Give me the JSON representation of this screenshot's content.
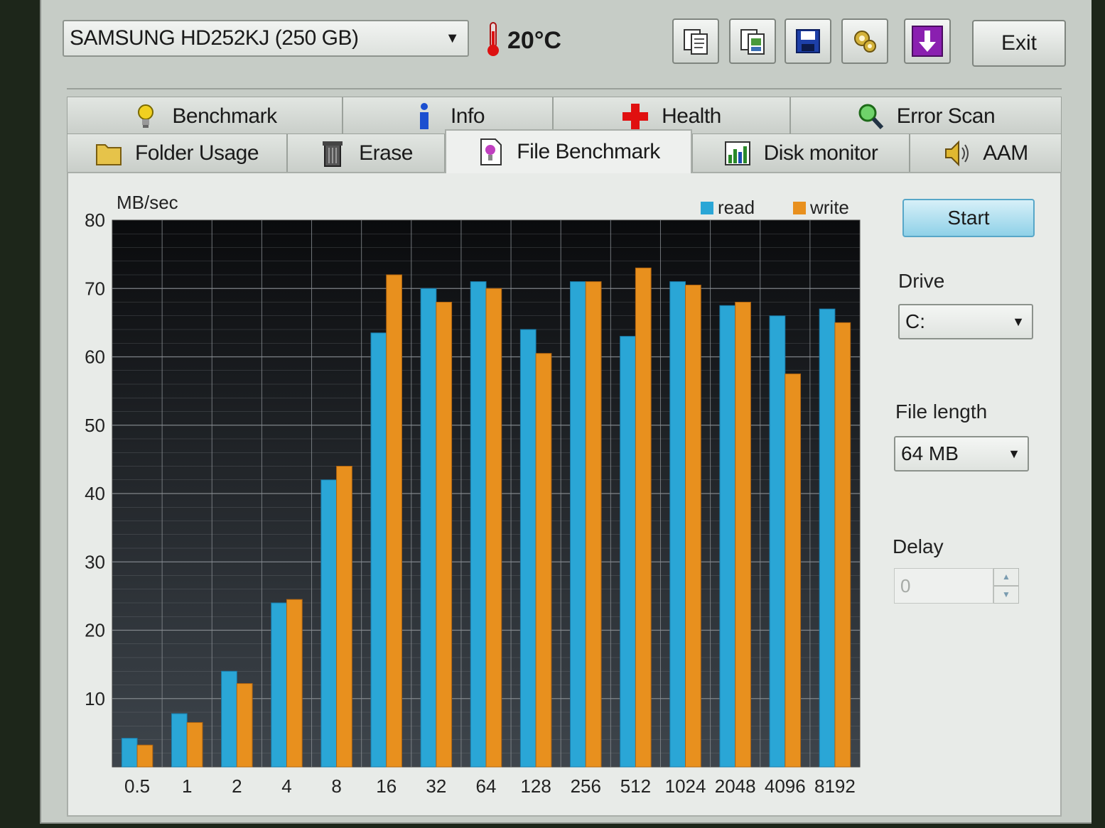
{
  "toolbar": {
    "drive": "SAMSUNG HD252KJ (250 GB)",
    "temperature": "20°C",
    "exit_label": "Exit",
    "buttons": [
      {
        "icon": "copy-text-icon"
      },
      {
        "icon": "copy-screenshot-icon"
      },
      {
        "icon": "save-icon"
      },
      {
        "icon": "options-icon"
      },
      {
        "icon": "download-icon"
      }
    ]
  },
  "tabs": {
    "row1": [
      {
        "label": "Benchmark",
        "icon": "benchmark-icon"
      },
      {
        "label": "Info",
        "icon": "info-icon"
      },
      {
        "label": "Health",
        "icon": "health-icon"
      },
      {
        "label": "Error Scan",
        "icon": "error-scan-icon"
      }
    ],
    "row2": [
      {
        "label": "Folder Usage",
        "icon": "folder-icon"
      },
      {
        "label": "Erase",
        "icon": "erase-icon"
      },
      {
        "label": "File Benchmark",
        "icon": "file-benchmark-icon",
        "active": true
      },
      {
        "label": "Disk monitor",
        "icon": "disk-monitor-icon"
      },
      {
        "label": "AAM",
        "icon": "aam-icon"
      }
    ]
  },
  "side": {
    "start_label": "Start",
    "drive_label": "Drive",
    "drive_value": "C:",
    "file_length_label": "File length",
    "file_length_value": "64 MB",
    "delay_label": "Delay",
    "delay_value": "0"
  },
  "colors": {
    "read": "#2aa6d6",
    "write": "#e8901e",
    "plot_bg_top": "#0a0b0d",
    "plot_bg_bottom": "#3e454c",
    "grid": "#8a8f94"
  },
  "chart_data": {
    "type": "bar",
    "ylabel": "MB/sec",
    "ylim": [
      0,
      80
    ],
    "yticks": [
      10,
      20,
      30,
      40,
      50,
      60,
      70,
      80
    ],
    "categories": [
      "0.5",
      "1",
      "2",
      "4",
      "8",
      "16",
      "32",
      "64",
      "128",
      "256",
      "512",
      "1024",
      "2048",
      "4096",
      "8192"
    ],
    "series": [
      {
        "name": "read",
        "values": [
          4.2,
          7.8,
          14.0,
          24.0,
          42.0,
          63.5,
          70.0,
          71.0,
          64.0,
          71.0,
          63.0,
          71.0,
          67.5,
          66.0,
          67.0
        ]
      },
      {
        "name": "write",
        "values": [
          3.2,
          6.5,
          12.2,
          24.5,
          44.0,
          72.0,
          68.0,
          70.0,
          60.5,
          71.0,
          73.0,
          70.5,
          68.0,
          57.5,
          65.0
        ]
      }
    ],
    "legend": "top-right",
    "grid": true
  }
}
